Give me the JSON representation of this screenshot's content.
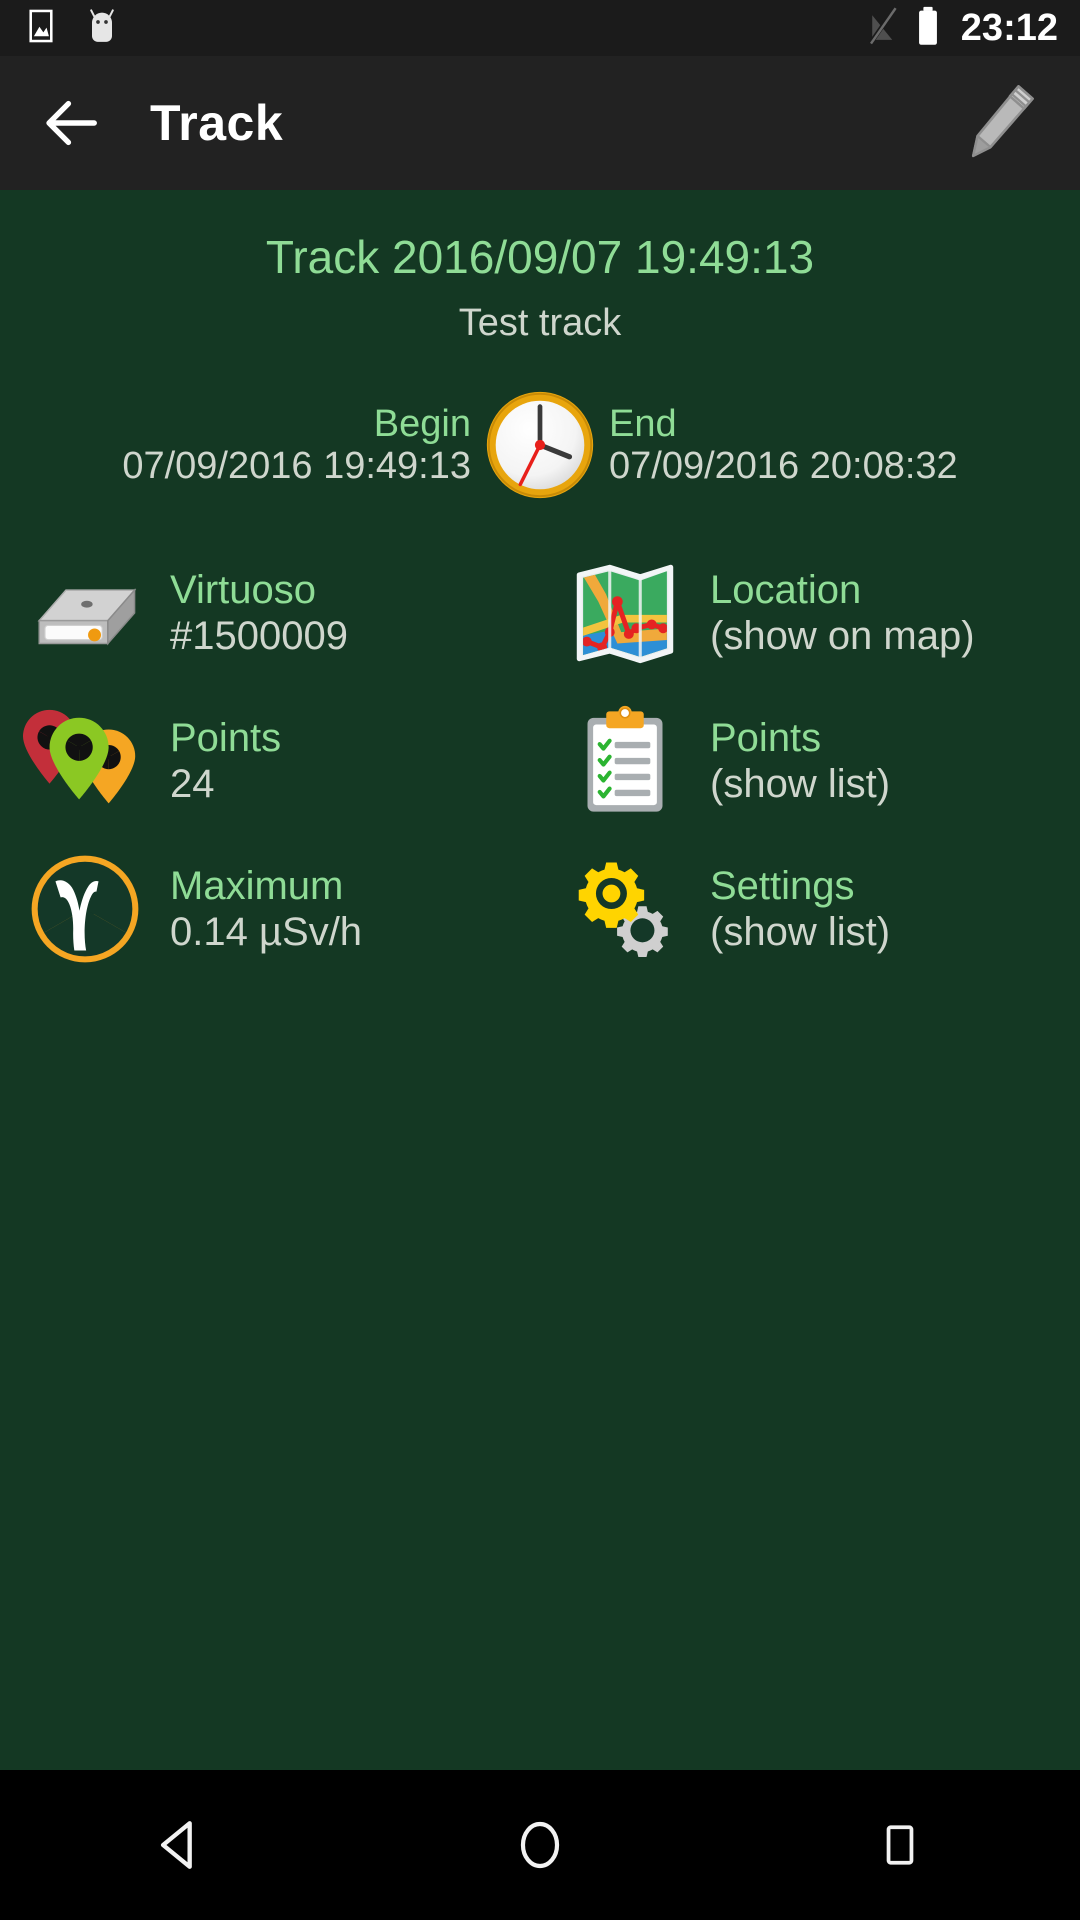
{
  "status_bar": {
    "icons": [
      "image-icon",
      "android-mascot-icon",
      "signal-off-icon",
      "battery-full-icon"
    ],
    "time": "23:12"
  },
  "app_bar": {
    "back_icon": "back-arrow-icon",
    "title": "Track",
    "edit_icon": "pencil-icon"
  },
  "track": {
    "title": "Track 2016/09/07 19:49:13",
    "subtitle": "Test track",
    "begin_label": "Begin",
    "begin_value": "07/09/2016 19:49:13",
    "end_label": "End",
    "end_value": "07/09/2016 20:08:32",
    "clock_icon": "clock-icon"
  },
  "info": [
    {
      "icon": "device-icon",
      "label": "Virtuoso",
      "value": "#1500009"
    },
    {
      "icon": "map-icon",
      "label": "Location",
      "value": "(show on map)"
    },
    {
      "icon": "radiation-markers-icon",
      "label": "Points",
      "value": "24"
    },
    {
      "icon": "clipboard-icon",
      "label": "Points",
      "value": "(show list)"
    },
    {
      "icon": "gamma-radiation-icon",
      "label": "Maximum",
      "value": "0.14 µSv/h"
    },
    {
      "icon": "gears-icon",
      "label": "Settings",
      "value": "(show list)"
    }
  ],
  "nav_bar": {
    "back": "nav-back-icon",
    "home": "nav-home-icon",
    "recents": "nav-recents-icon"
  },
  "colors": {
    "background": "#143828",
    "accent_green": "#8fdc96",
    "value_gray": "#cfd6cd",
    "app_bar": "#222222",
    "status_bar": "#1b1b1b",
    "nav_bar": "#000000",
    "orange": "#f5a623",
    "yellow": "#ffd400"
  }
}
